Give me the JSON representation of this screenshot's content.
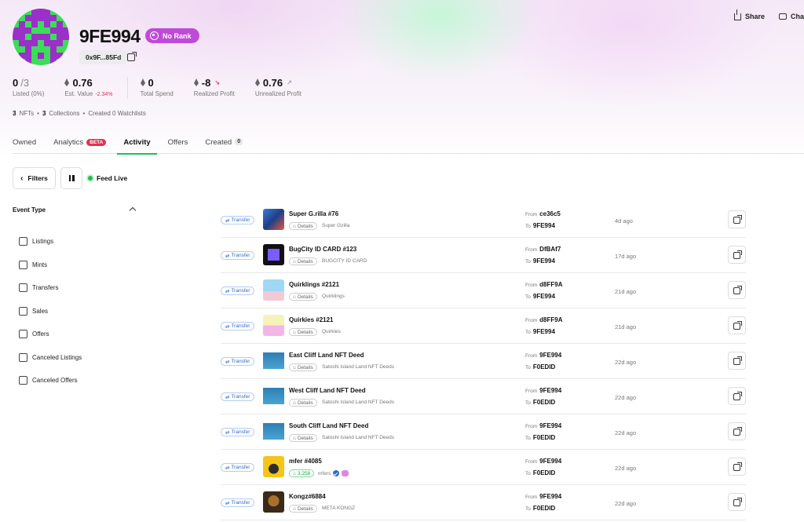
{
  "profile": {
    "username": "9FE994",
    "rank_label": "No Rank",
    "address": "0x9F...85Fd"
  },
  "top_actions": {
    "share": "Share",
    "chat": "Cha"
  },
  "stats": {
    "listed_value": "0",
    "listed_total": "/3",
    "listed_label": "Listed (0%)",
    "est_value": "0.76",
    "est_change": "-2.34%",
    "est_label": "Est. Value",
    "total_spend": "0",
    "total_spend_label": "Total Spend",
    "realized": "-8",
    "realized_label": "Realized Profit",
    "unrealized": "0.76",
    "unrealized_label": "Unrealized Profit"
  },
  "meta": {
    "nfts_count": "3",
    "nfts_label": "NFTs",
    "collections_count": "3",
    "collections_label": "Collections",
    "watchlists": "Created 0 Watchlists"
  },
  "tabs": [
    {
      "label": "Owned"
    },
    {
      "label": "Analytics",
      "badge": "BETA"
    },
    {
      "label": "Activity"
    },
    {
      "label": "Offers"
    },
    {
      "label": "Created",
      "count": "0"
    }
  ],
  "toolbar": {
    "filters_label": "Filters",
    "live_label": "Feed Live"
  },
  "event_type": {
    "title": "Event Type",
    "options": [
      "Listings",
      "Mints",
      "Transfers",
      "Sales",
      "Offers",
      "Canceled Listings",
      "Canceled Offers"
    ]
  },
  "activity": [
    {
      "type": "Transfer",
      "name": "Super G.rilla #76",
      "details": "Details",
      "collection": "Super Gzilla",
      "from_label": "From",
      "from": "ce36c5",
      "to_label": "To",
      "to": "9FE994",
      "ago": "4d ago"
    },
    {
      "type": "Transfer",
      "name": "BugCity ID CARD #123",
      "details": "Details",
      "collection": "BUGCITY ID CARD",
      "from_label": "From",
      "from": "DfBAf7",
      "to_label": "To",
      "to": "9FE994",
      "ago": "17d ago"
    },
    {
      "type": "Transfer",
      "name": "Quirklings #2121",
      "details": "Details",
      "collection": "Quirklings",
      "from_label": "From",
      "from": "d8FF9A",
      "to_label": "To",
      "to": "9FE994",
      "ago": "21d ago"
    },
    {
      "type": "Transfer",
      "name": "Quirkies #2121",
      "details": "Details",
      "collection": "Quirkies",
      "from_label": "From",
      "from": "d8FF9A",
      "to_label": "To",
      "to": "9FE994",
      "ago": "21d ago"
    },
    {
      "type": "Transfer",
      "name": "East Cliff Land NFT Deed",
      "details": "Details",
      "collection": "Satoshi Island Land NFT Deeds",
      "from_label": "From",
      "from": "9FE994",
      "to_label": "To",
      "to": "F0EDID",
      "ago": "22d ago"
    },
    {
      "type": "Transfer",
      "name": "West Cliff Land NFT Deed",
      "details": "Details",
      "collection": "Satoshi Island Land NFT Deeds",
      "from_label": "From",
      "from": "9FE994",
      "to_label": "To",
      "to": "F0EDID",
      "ago": "22d ago"
    },
    {
      "type": "Transfer",
      "name": "South Cliff Land NFT Deed",
      "details": "Details",
      "collection": "Satoshi Island Land NFT Deeds",
      "from_label": "From",
      "from": "9FE994",
      "to_label": "To",
      "to": "F0EDID",
      "ago": "22d ago"
    },
    {
      "type": "Transfer",
      "name": "mfer #4085",
      "details": "3.258",
      "collection": "mfers",
      "from_label": "From",
      "from": "9FE994",
      "to_label": "To",
      "to": "F0EDID",
      "ago": "22d ago"
    },
    {
      "type": "Transfer",
      "name": "Kongz#6884",
      "details": "Details",
      "collection": "META KONGZ",
      "from_label": "From",
      "from": "9FE994",
      "to_label": "To",
      "to": "F0EDID",
      "ago": "22d ago"
    }
  ],
  "colors": {
    "accent_green": "#1fbf5a",
    "rank_purple": "#c04ad8",
    "negative_red": "#e0334f",
    "transfer_blue": "#2f6ad0"
  }
}
